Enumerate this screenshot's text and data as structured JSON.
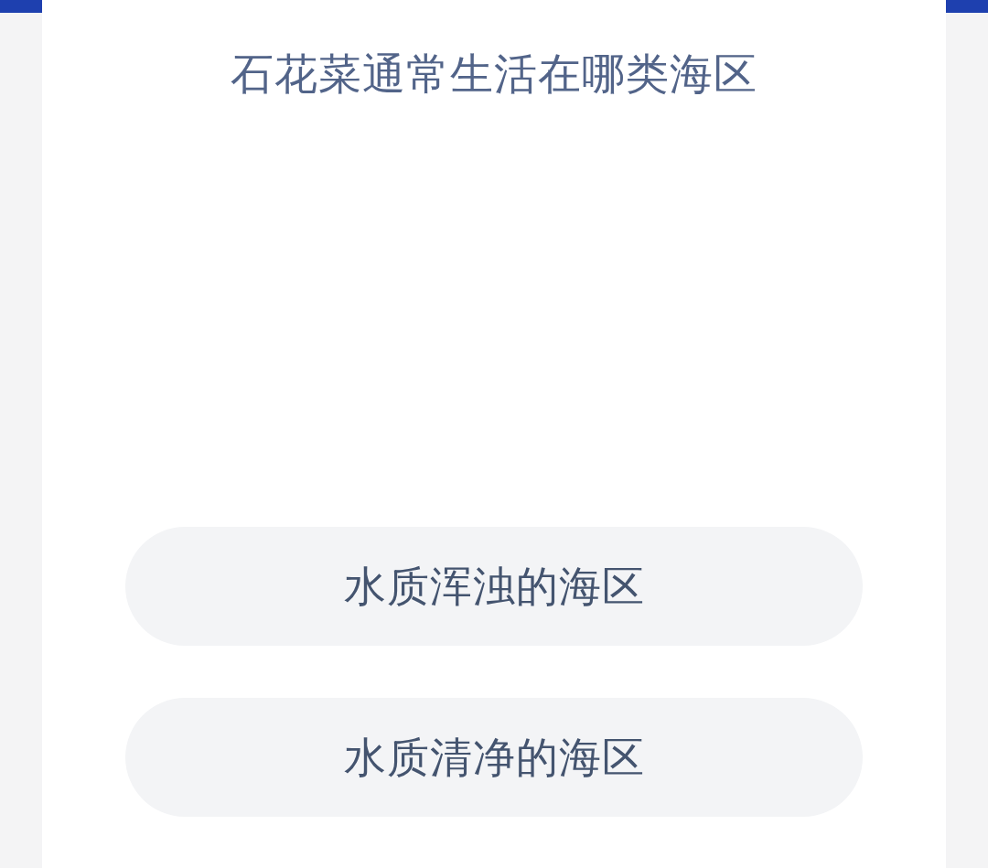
{
  "question": "石花菜通常生活在哪类海区",
  "options": [
    {
      "label": "水质浑浊的海区"
    },
    {
      "label": "水质清净的海区"
    }
  ]
}
